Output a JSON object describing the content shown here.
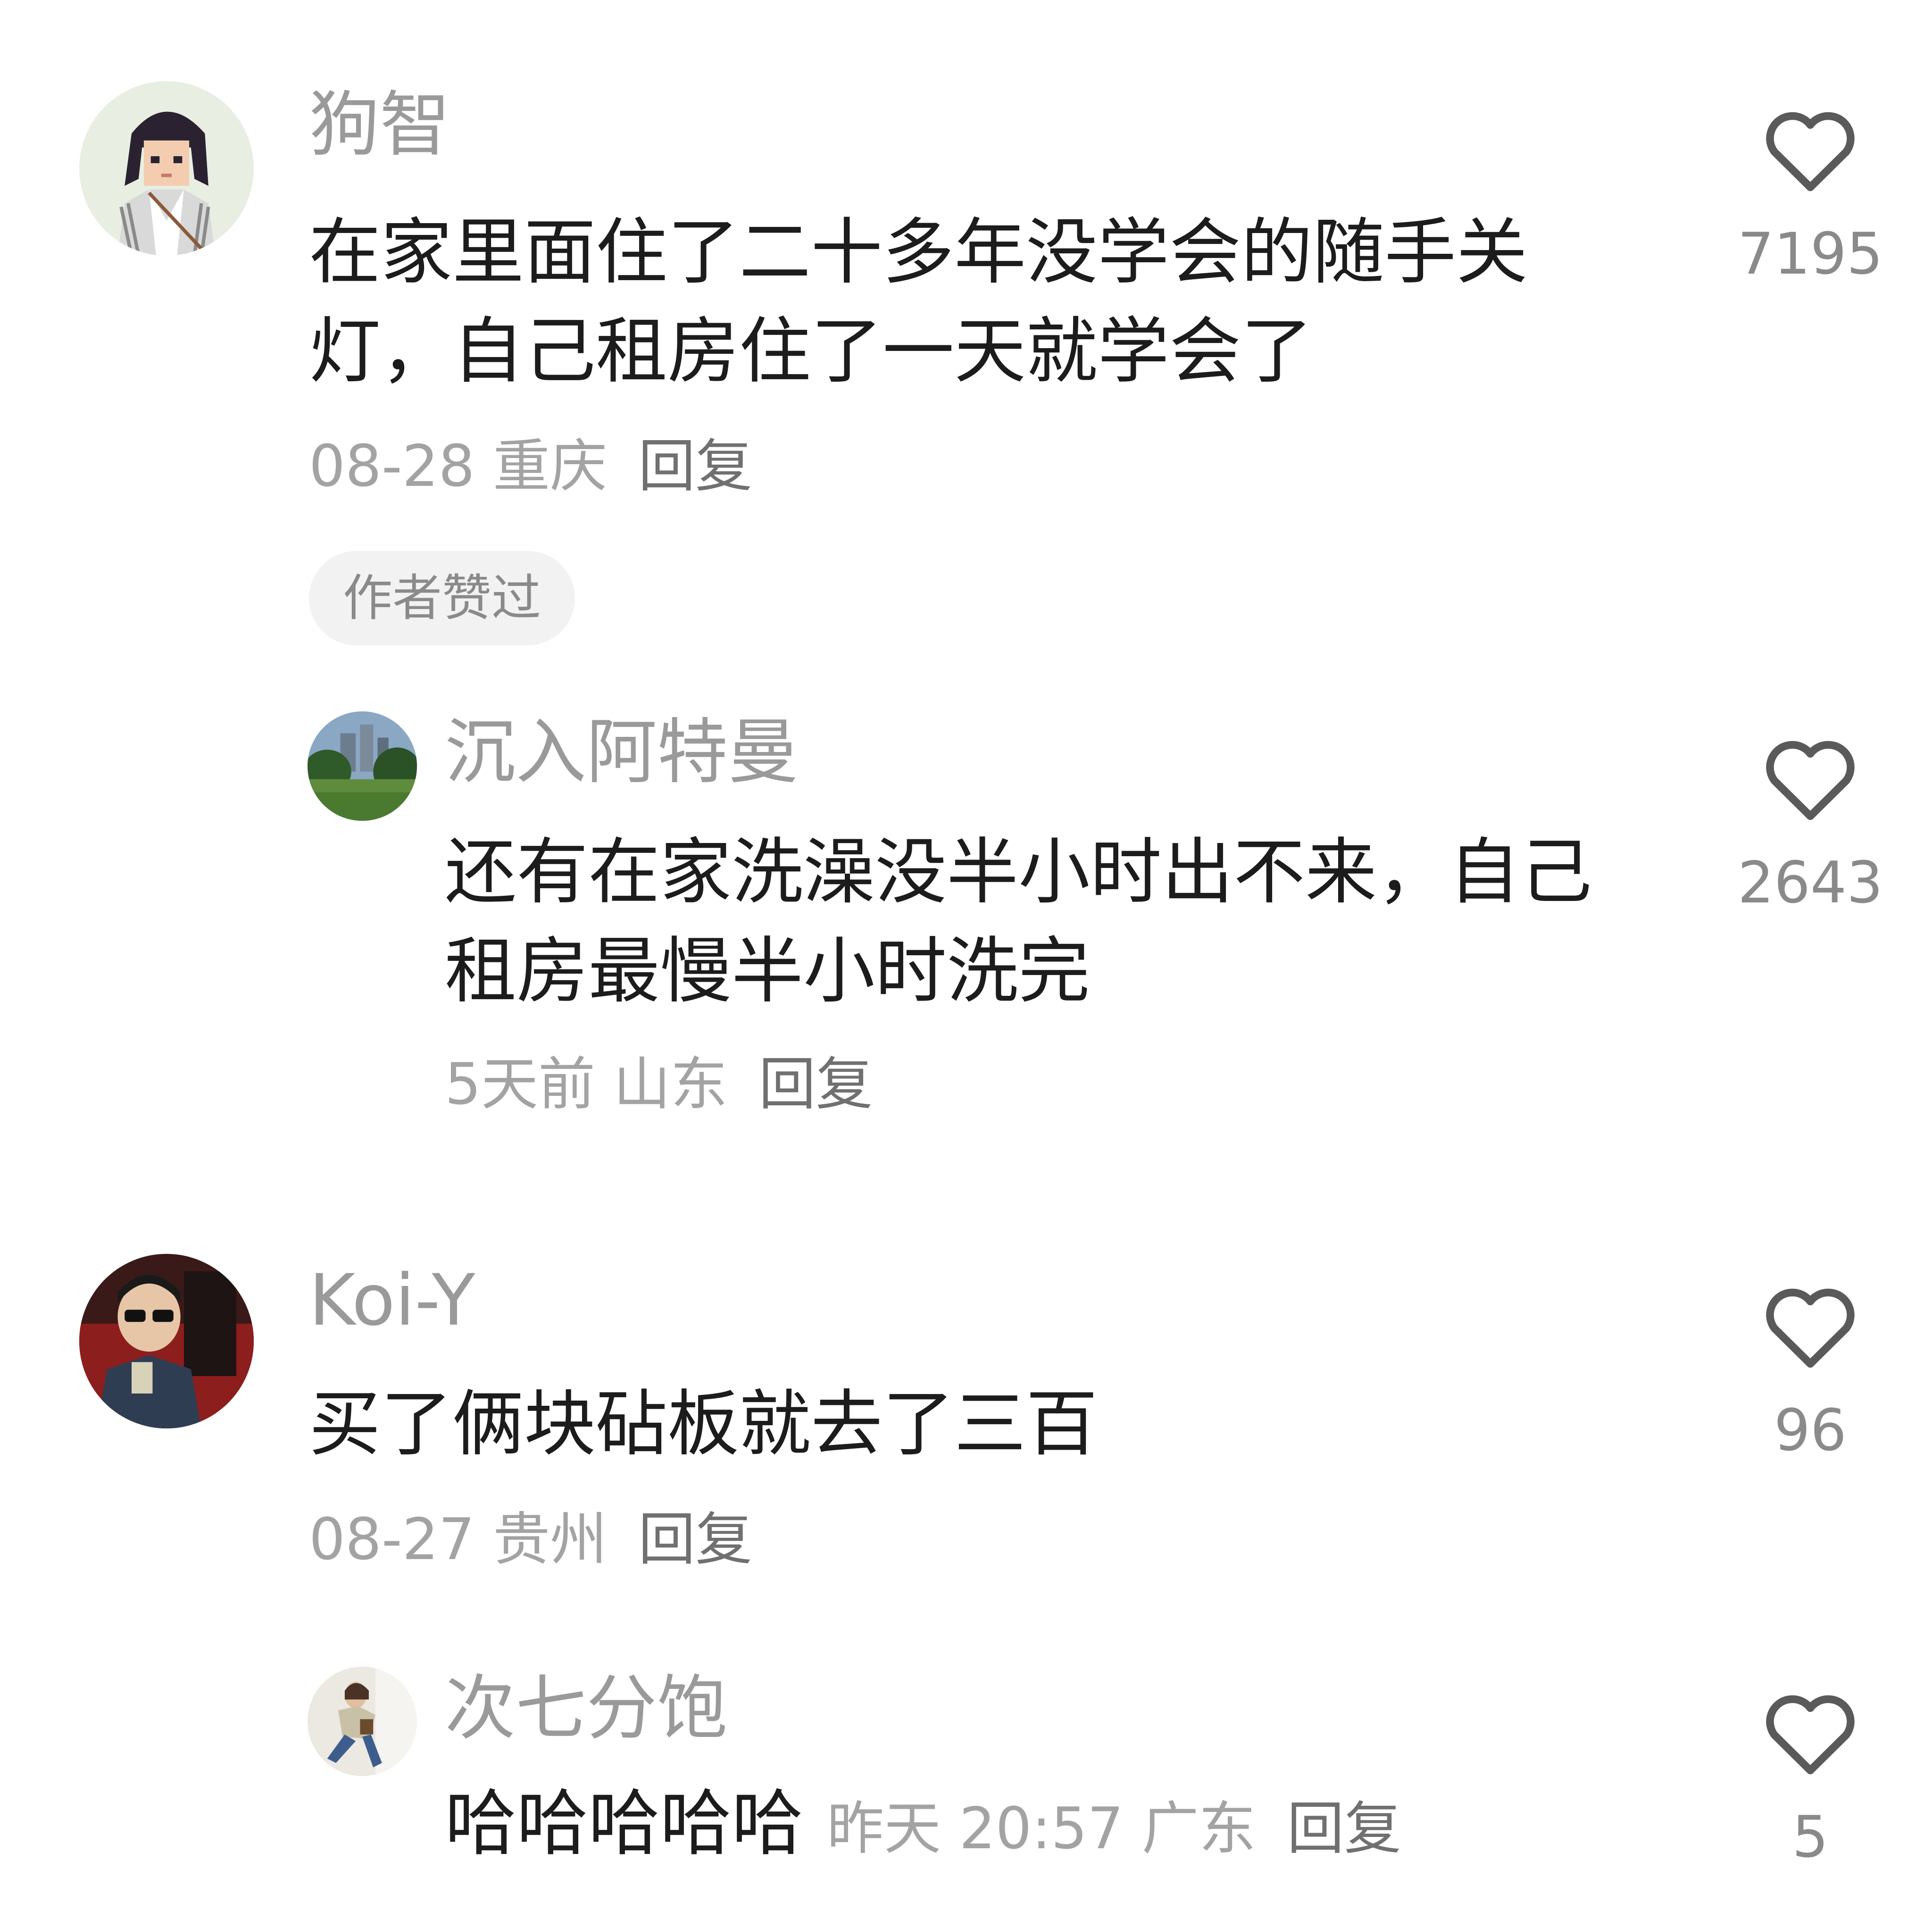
{
  "colors": {
    "username": "#9a9a9a",
    "content": "#1c1c1c",
    "meta": "#a3a3a3",
    "reply": "#707070",
    "badge_bg": "#f2f2f2",
    "heart_stroke": "#5a5a5a"
  },
  "comments": [
    {
      "username": "狗智",
      "content": "在家里面住了二十多年没学会的随手关灯，自己租房住了一天就学会了",
      "date_loc": "08-28 重庆",
      "reply": "回复",
      "badge": "作者赞过",
      "likes": "7195",
      "avatar_icon": "pixel-art-girl-avatar",
      "replies": [
        {
          "username": "沉入阿特曼",
          "content": "还有在家洗澡没半小时出不来，自己租房最慢半小时洗完",
          "date_loc": "5天前 山东",
          "reply": "回复",
          "likes": "2643",
          "avatar_icon": "park-landscape-avatar"
        }
      ]
    },
    {
      "username": "Koi-Y",
      "content": "买了俩块砧板就去了三百",
      "date_loc": "08-27 贵州",
      "reply": "回复",
      "likes": "96",
      "avatar_icon": "sunglasses-person-avatar",
      "replies": [
        {
          "username": "次七分饱",
          "content": "哈哈哈哈哈",
          "date_loc": "昨天 20:57 广东",
          "reply": "回复",
          "likes": "5",
          "avatar_icon": "jumping-person-avatar"
        }
      ]
    }
  ]
}
